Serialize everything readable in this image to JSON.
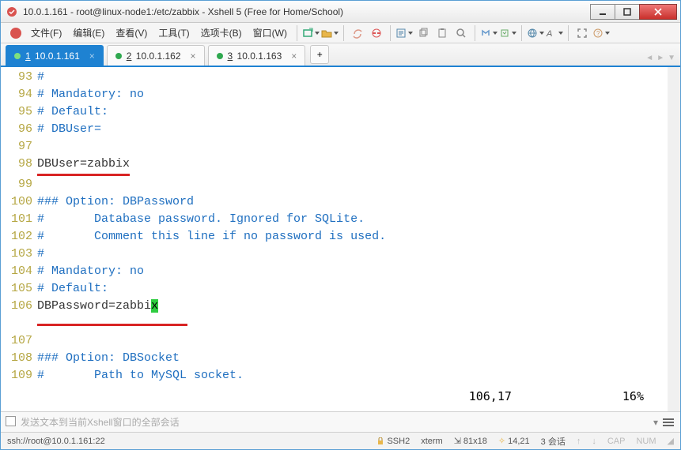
{
  "window": {
    "title": "10.0.1.161 - root@linux-node1:/etc/zabbix - Xshell 5 (Free for Home/School)"
  },
  "menu": {
    "file": "文件(F)",
    "edit": "编辑(E)",
    "view": "查看(V)",
    "tools": "工具(T)",
    "tabs": "选项卡(B)",
    "window": "窗口(W)"
  },
  "tabs": [
    {
      "num": "1",
      "label": "10.0.1.161",
      "active": true
    },
    {
      "num": "2",
      "label": "10.0.1.162",
      "active": false
    },
    {
      "num": "3",
      "label": "10.0.1.163",
      "active": false
    }
  ],
  "editor": {
    "lines": [
      {
        "n": "93",
        "text": "#",
        "cls": "cmt"
      },
      {
        "n": "94",
        "text": "# Mandatory: no",
        "cls": "cmt"
      },
      {
        "n": "95",
        "text": "# Default:",
        "cls": "cmt"
      },
      {
        "n": "96",
        "text": "# DBUser=",
        "cls": "cmt"
      },
      {
        "n": "97",
        "text": "",
        "cls": ""
      },
      {
        "n": "98",
        "text": "DBUser=zabbix",
        "cls": "kw",
        "ul": true
      },
      {
        "n": "99",
        "text": "",
        "cls": ""
      },
      {
        "n": "100",
        "text": "### Option: DBPassword",
        "cls": "cmt"
      },
      {
        "n": "101",
        "text": "#       Database password. Ignored for SQLite.",
        "cls": "cmt"
      },
      {
        "n": "102",
        "text": "#       Comment this line if no password is used.",
        "cls": "cmt"
      },
      {
        "n": "103",
        "text": "#",
        "cls": "cmt"
      },
      {
        "n": "104",
        "text": "# Mandatory: no",
        "cls": "cmt"
      },
      {
        "n": "105",
        "text": "# Default:",
        "cls": "cmt"
      },
      {
        "n": "106",
        "text_pre": "DBPassword=zabbi",
        "text_cursor": "x",
        "cls": "kw",
        "ul2": true
      },
      {
        "n": "107",
        "text": "",
        "cls": ""
      },
      {
        "n": "108",
        "text": "### Option: DBSocket",
        "cls": "cmt"
      },
      {
        "n": "109",
        "text": "#       Path to MySQL socket.",
        "cls": "cmt"
      }
    ],
    "position": "106,17",
    "percent": "16%"
  },
  "inputbar": {
    "placeholder": "发送文本到当前Xshell窗口的全部会话"
  },
  "status": {
    "conn": "ssh://root@10.0.1.161:22",
    "proto": "SSH2",
    "term": "xterm",
    "size": "81x18",
    "cursor": "14,21",
    "sessions": "3 会话",
    "cap": "CAP",
    "num": "NUM"
  }
}
